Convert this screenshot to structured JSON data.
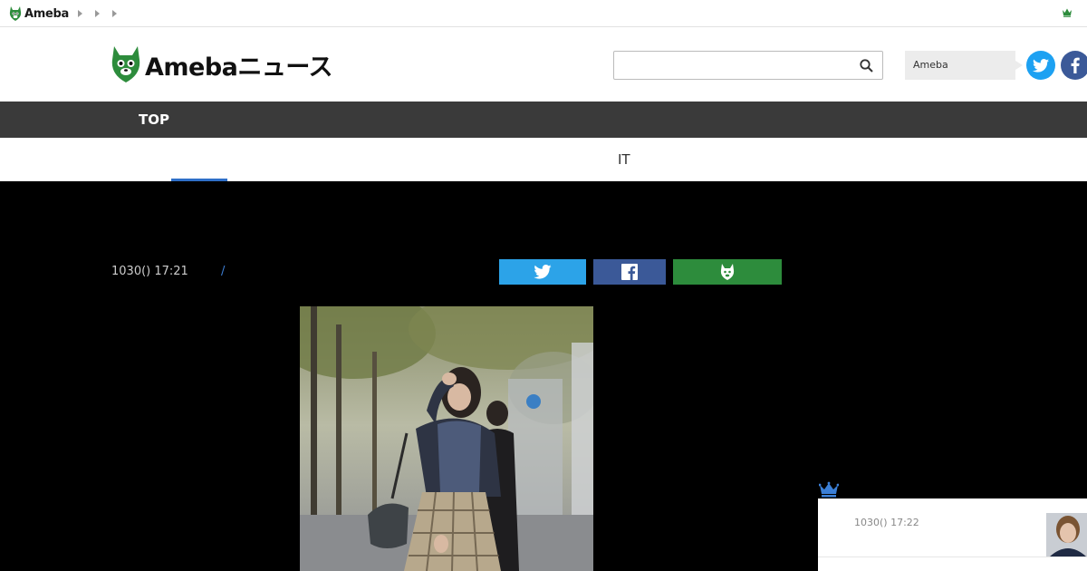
{
  "topbar": {
    "brand": "Ameba",
    "crown_icon": "crown-icon"
  },
  "header": {
    "logo_text": "Amebaニュース",
    "search": {
      "placeholder": "",
      "value": ""
    },
    "login_label": "Ameba",
    "social": [
      "twitter-icon",
      "facebook-icon"
    ]
  },
  "global_nav": {
    "items": [
      {
        "label": "TOP"
      }
    ]
  },
  "sub_nav": {
    "items": [
      {
        "label": "IT"
      }
    ]
  },
  "article": {
    "date": "1030() 17:21",
    "category_separator": "/",
    "share_buttons": [
      "twitter-icon",
      "facebook-icon",
      "ameba-icon"
    ]
  },
  "ranking": {
    "date": "1030() 17:22"
  },
  "colors": {
    "nav_bg": "#3a3a3a",
    "twitter": "#2ca3e8",
    "facebook": "#3b5998",
    "ameba_green": "#2d8c3c",
    "accent_blue": "#2f6fc8"
  }
}
